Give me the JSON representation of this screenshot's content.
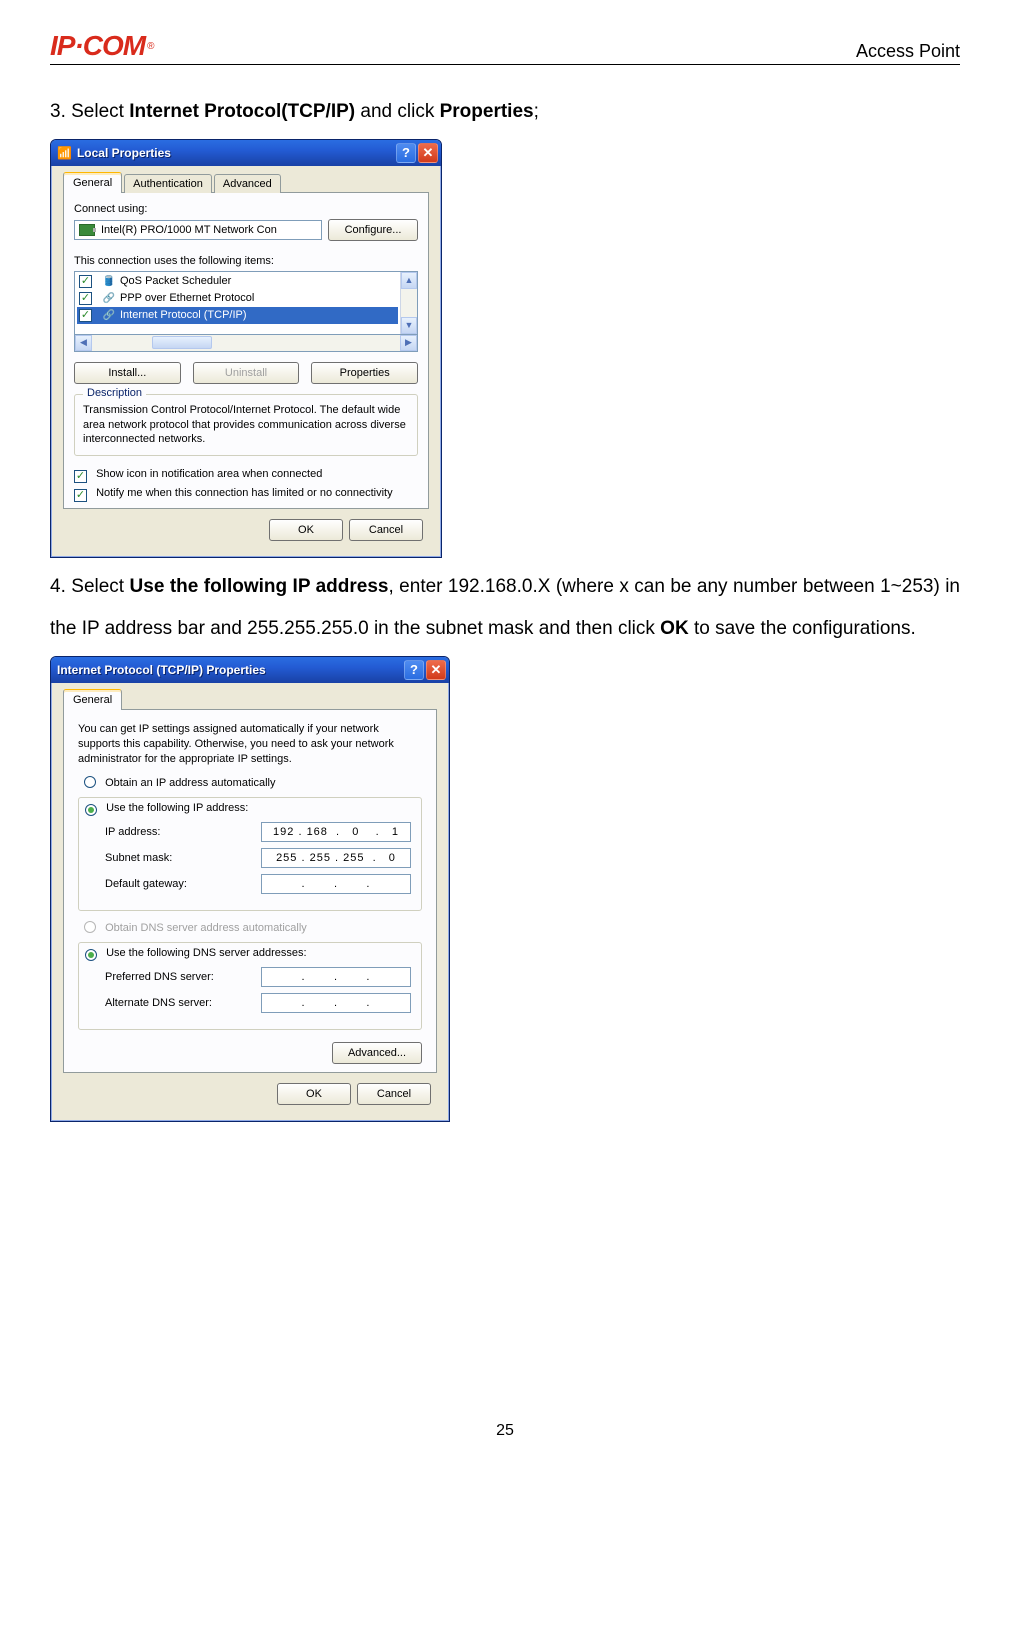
{
  "header": {
    "logo_text": "IP·COM",
    "logo_r": "®",
    "right": "Access Point"
  },
  "step3": {
    "prefix": "3. Select ",
    "bold1": "Internet Protocol(TCP/IP)",
    "mid": " and click ",
    "bold2": "Properties",
    "suffix": ";"
  },
  "step4": {
    "prefix": "4. Select ",
    "bold1": "Use the following IP address",
    "mid1": ", enter 192.168.0.X (where x can be any number between 1~253) in the IP address bar and 255.255.255.0 in the subnet mask and then click ",
    "bold2": "OK",
    "suffix": " to save the configurations."
  },
  "pagenum": "25",
  "local": {
    "title": "Local Properties",
    "tabs": {
      "general": "General",
      "auth": "Authentication",
      "adv": "Advanced"
    },
    "connect_using": "Connect using:",
    "adapter": "Intel(R) PRO/1000 MT Network Con",
    "configure": "Configure...",
    "uses": "This connection uses the following items:",
    "items": {
      "qos": "QoS Packet Scheduler",
      "ppp": "PPP over Ethernet Protocol",
      "tcpip": "Internet Protocol (TCP/IP)"
    },
    "install": "Install...",
    "uninstall": "Uninstall",
    "properties": "Properties",
    "desc_title": "Description",
    "desc_text": "Transmission Control Protocol/Internet Protocol. The default wide area network protocol that provides communication across diverse interconnected networks.",
    "show_icon": "Show icon in notification area when connected",
    "notify": "Notify me when this connection has limited or no connectivity",
    "ok": "OK",
    "cancel": "Cancel"
  },
  "tcp": {
    "title": "Internet Protocol (TCP/IP) Properties",
    "tab": "General",
    "intro": "You can get IP settings assigned automatically if your network supports this capability. Otherwise, you need to ask your network administrator for the appropriate IP settings.",
    "obtain_ip": "Obtain an IP address automatically",
    "use_ip": "Use the following IP address:",
    "ip_label": "IP address:",
    "ip_value": "192 . 168  .   0    .   1",
    "subnet_label": "Subnet mask:",
    "subnet_value": "255 . 255 . 255  .   0",
    "gateway_label": "Default gateway:",
    "gateway_value": ".       .       .",
    "obtain_dns": "Obtain DNS server address automatically",
    "use_dns": "Use the following DNS server addresses:",
    "pref_dns": "Preferred DNS server:",
    "alt_dns": "Alternate DNS server:",
    "dns_value": ".       .       .",
    "advanced": "Advanced...",
    "ok": "OK",
    "cancel": "Cancel"
  }
}
